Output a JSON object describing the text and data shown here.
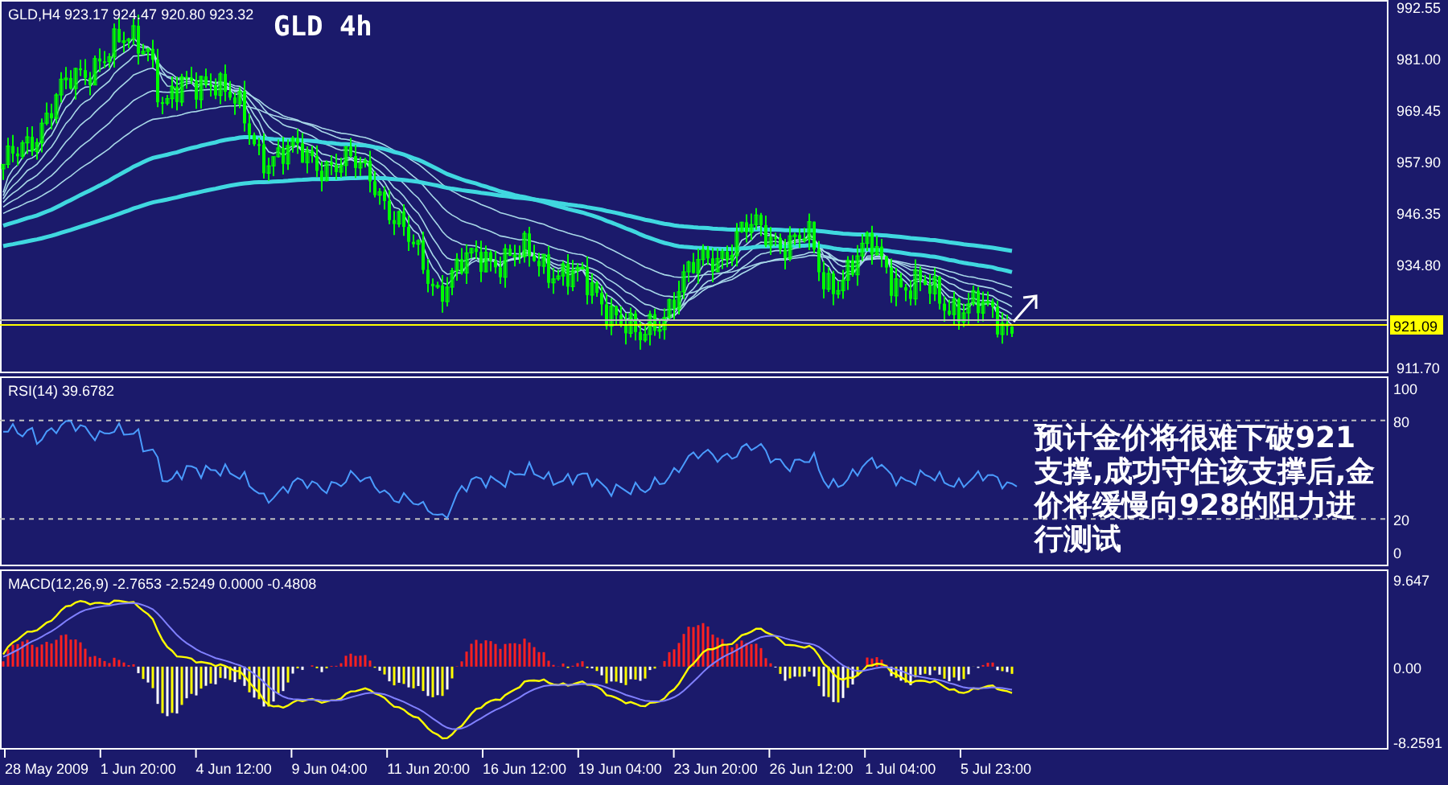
{
  "price_panel": {
    "header": "GLD,H4  923.17 924.47 920.80 923.32",
    "annotation": "GLD 4h",
    "current_price": "921.09",
    "axis_labels": [
      "992.55",
      "981.00",
      "969.45",
      "957.90",
      "946.35",
      "934.80",
      "911.70"
    ]
  },
  "rsi_panel": {
    "header": "RSI(14) 39.6782",
    "axis_labels": [
      "100",
      "80",
      "20",
      "0"
    ]
  },
  "macd_panel": {
    "header": "MACD(12,26,9) -2.7653 -2.5249 0.0000 -0.4808",
    "axis_labels": [
      "9.647",
      "0.00",
      "-8.2591"
    ]
  },
  "time_axis": [
    "28 May 2009",
    "1 Jun 20:00",
    "4 Jun 12:00",
    "9 Jun 04:00",
    "11 Jun 20:00",
    "16 Jun 12:00",
    "19 Jun 04:00",
    "23 Jun 20:00",
    "26 Jun 12:00",
    "1 Jul 04:00",
    "5 Jul 23:00"
  ],
  "comment": "预计金价将很难下破921支撑,成功守住该支撑后,金价将缓慢向928的阻力进行测试"
}
